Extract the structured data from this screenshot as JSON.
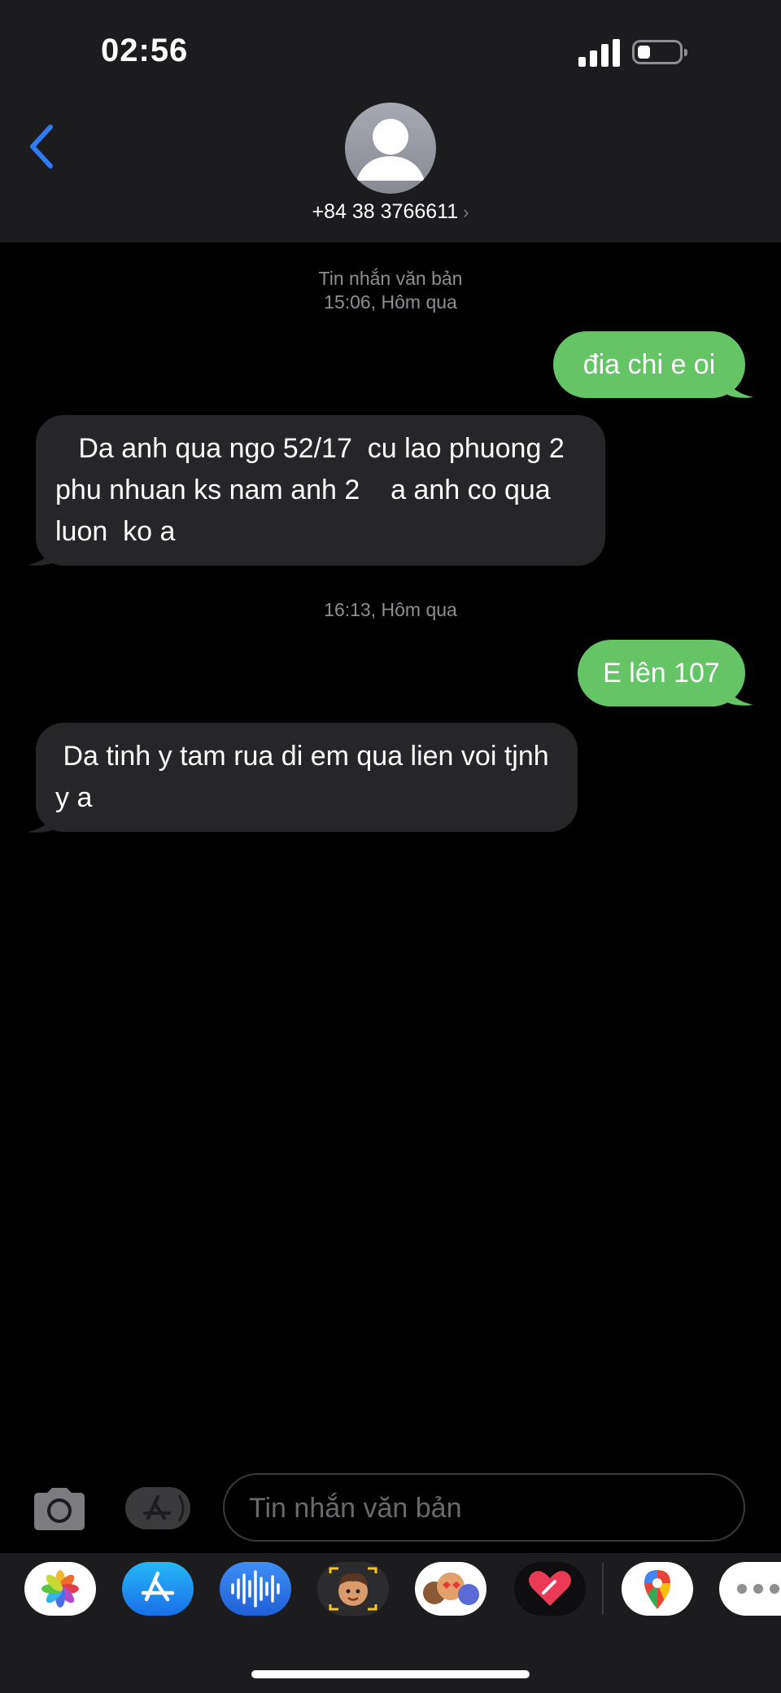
{
  "status_bar": {
    "time": "02:56"
  },
  "header": {
    "contact": "+84 38 3766611",
    "contact_chevron": "›"
  },
  "conversation": {
    "thread_label": "Tin nhắn văn bản",
    "stamp1": "15:06, Hôm qua",
    "msg1": "đia chi e oi",
    "msg2": "   Da anh qua ngo 52/17  cu lao phuong 2 phu nhuan ks nam anh 2    a anh co qua luon  ko a",
    "stamp2": "16:13, Hôm qua",
    "msg3": "E lên 107",
    "msg4": " Da tinh y tam rua di em qua lien voi tjnh y a"
  },
  "composer": {
    "placeholder": "Tin nhắn văn bản"
  },
  "colors": {
    "outgoing": "#65c466",
    "incoming": "#262628",
    "accent": "#2f7bf5"
  },
  "icons": [
    "back-chevron-icon",
    "camera-icon",
    "app-store-icon",
    "photos-app-icon",
    "app-store-app-icon",
    "audio-message-icon",
    "memoji-icon",
    "animoji-stickers-icon",
    "digital-touch-icon",
    "google-maps-icon",
    "more-apps-icon"
  ]
}
